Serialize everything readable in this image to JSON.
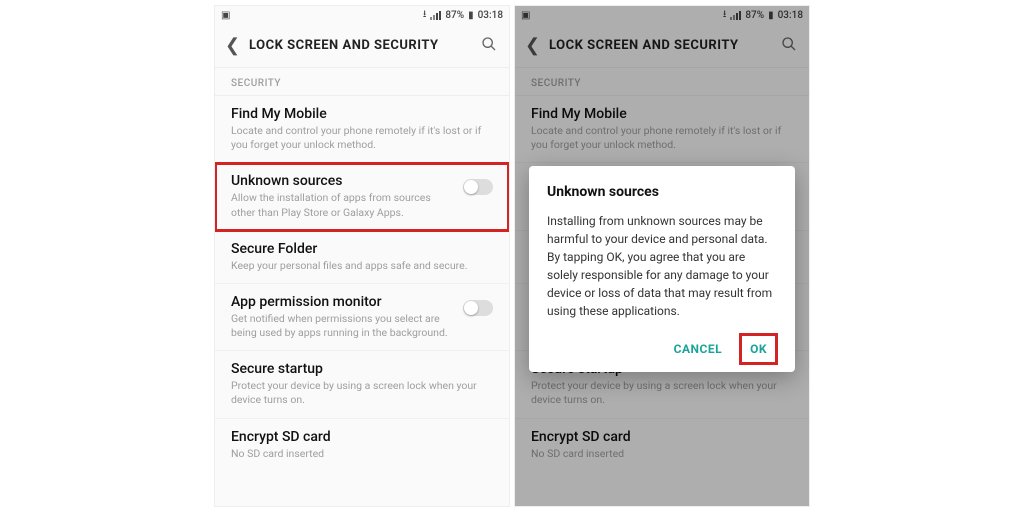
{
  "status": {
    "battery_pct": "87%",
    "time": "03:18"
  },
  "appbar": {
    "title": "LOCK SCREEN AND SECURITY"
  },
  "section_header": "SECURITY",
  "items": {
    "find_my_mobile": {
      "title": "Find My Mobile",
      "desc": "Locate and control your phone remotely if it's lost or if you forget your unlock method."
    },
    "unknown_sources": {
      "title": "Unknown sources",
      "desc": "Allow the installation of apps from sources other than Play Store or Galaxy Apps."
    },
    "secure_folder": {
      "title": "Secure Folder",
      "desc": "Keep your personal files and apps safe and secure."
    },
    "app_permission_monitor": {
      "title": "App permission monitor",
      "desc": "Get notified when permissions you select are being used by apps running in the background."
    },
    "secure_startup": {
      "title": "Secure startup",
      "desc": "Protect your device by using a screen lock when your device turns on."
    },
    "encrypt_sd": {
      "title": "Encrypt SD card",
      "desc": "No SD card inserted"
    }
  },
  "dialog": {
    "title": "Unknown sources",
    "body": "Installing from unknown sources may be harmful to your device and personal data. By tapping OK, you agree that you are solely responsible for any damage to your device or loss of data that may result from using these applications.",
    "cancel": "CANCEL",
    "ok": "OK"
  }
}
